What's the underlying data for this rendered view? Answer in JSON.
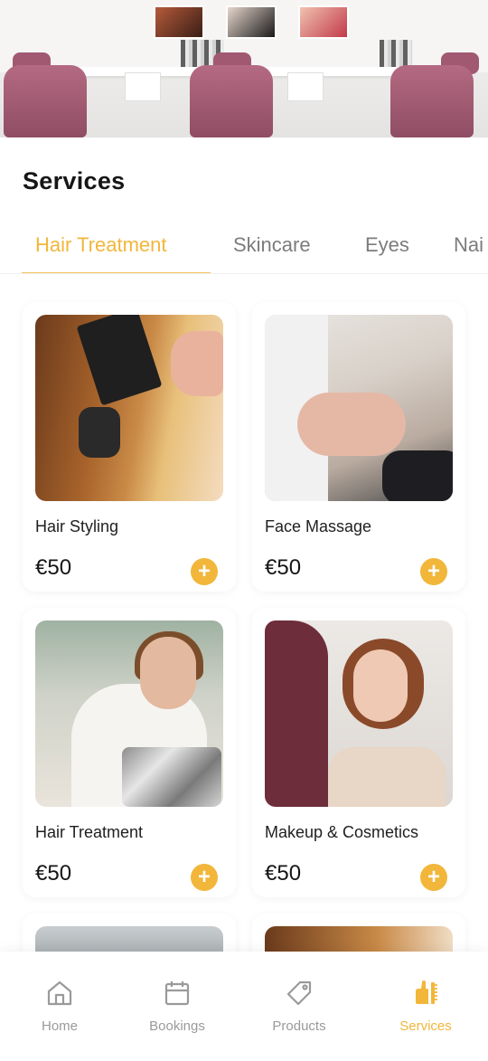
{
  "page": {
    "title": "Services"
  },
  "tabs": [
    {
      "label": "Hair Treatment",
      "active": true
    },
    {
      "label": "Skincare",
      "active": false
    },
    {
      "label": "Eyes",
      "active": false
    },
    {
      "label": "Nai",
      "active": false
    }
  ],
  "services": [
    {
      "name": "Hair Styling",
      "price": "€50",
      "image": "hair-styling-photo"
    },
    {
      "name": "Face Massage",
      "price": "€50",
      "image": "face-massage-photo"
    },
    {
      "name": "Hair Treatment",
      "price": "€50",
      "image": "hair-treatment-photo"
    },
    {
      "name": "Makeup & Cosmetics",
      "price": "€50",
      "image": "makeup-photo"
    }
  ],
  "add_button": {
    "symbol": "+"
  },
  "nav": [
    {
      "label": "Home",
      "icon": "home-icon",
      "active": false
    },
    {
      "label": "Bookings",
      "icon": "calendar-icon",
      "active": false
    },
    {
      "label": "Products",
      "icon": "tag-icon",
      "active": false
    },
    {
      "label": "Services",
      "icon": "hand-comb-icon",
      "active": true
    }
  ],
  "colors": {
    "accent": "#f2b63a",
    "inactive": "#9a9a9a",
    "text": "#161616"
  }
}
